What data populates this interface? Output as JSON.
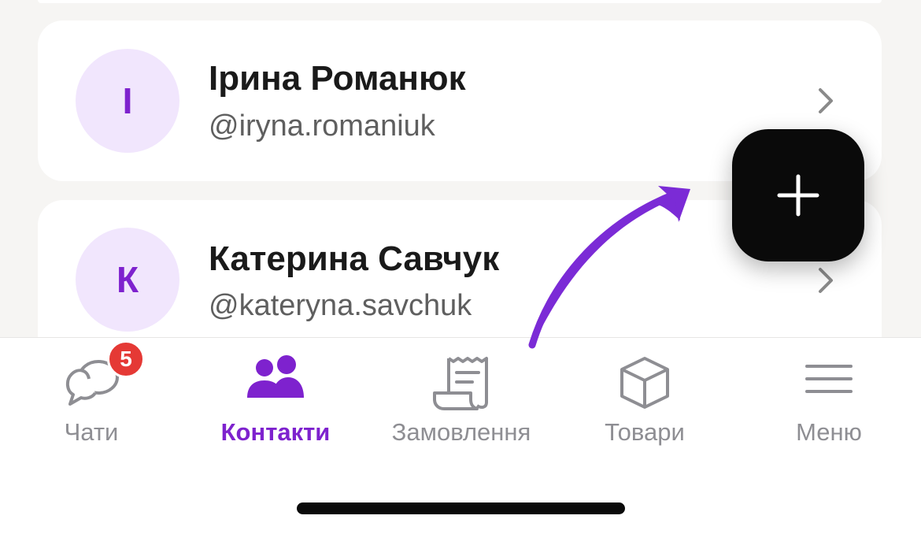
{
  "contacts": [
    {
      "initial": "І",
      "name": "Ірина Романюк",
      "handle": "@iryna.romaniuk"
    },
    {
      "initial": "К",
      "name": "Катерина Савчук",
      "handle": "@kateryna.savchuk"
    }
  ],
  "fab": {
    "icon": "plus-icon"
  },
  "tabbar": {
    "chats": {
      "label": "Чати",
      "badge": "5",
      "icon": "chat-bubbles-icon"
    },
    "contacts": {
      "label": "Контакти",
      "icon": "users-icon"
    },
    "orders": {
      "label": "Замовлення",
      "icon": "receipt-icon"
    },
    "products": {
      "label": "Товари",
      "icon": "box-icon"
    },
    "menu": {
      "label": "Меню",
      "icon": "hamburger-icon"
    }
  },
  "colors": {
    "accent": "#7E22CE",
    "avatar_bg": "#F1E6FD",
    "badge": "#E53935",
    "inactive": "#8E8E93",
    "fab": "#0A0A0A"
  }
}
